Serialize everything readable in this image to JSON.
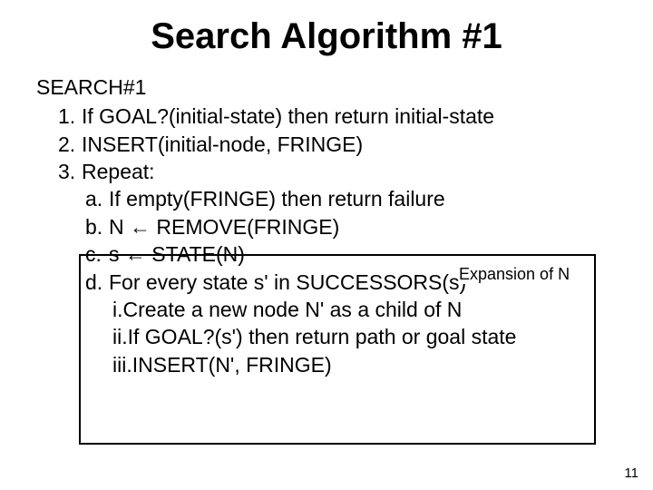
{
  "title": "Search Algorithm #1",
  "subhead": "SEARCH#1",
  "steps": {
    "s1": {
      "num": "1.",
      "text": "If GOAL?(initial-state) then return initial-state"
    },
    "s2": {
      "num": "2.",
      "text": "INSERT(initial-node, FRINGE)"
    },
    "s3": {
      "num": "3.",
      "text": "Repeat:"
    },
    "a": {
      "num": "a.",
      "prefix": "If empty(FRINGE) then return ",
      "fail": "failure"
    },
    "b": {
      "num": "b.",
      "text": "N ← REMOVE(FRINGE)"
    },
    "c": {
      "num": "c.",
      "text": "s ← STATE(N)"
    },
    "d": {
      "num": "d.",
      "text": "For every state s' in SUCCESSORS(s)"
    },
    "i": {
      "num": "i.",
      "text": "Create a new node N' as a child of N"
    },
    "ii": {
      "num": "ii.",
      "text": "If GOAL?(s') then return path or goal state"
    },
    "iii": {
      "num": "iii.",
      "text": "INSERT(N', FRINGE)"
    }
  },
  "annotation": "Expansion of N",
  "page_number": "11"
}
